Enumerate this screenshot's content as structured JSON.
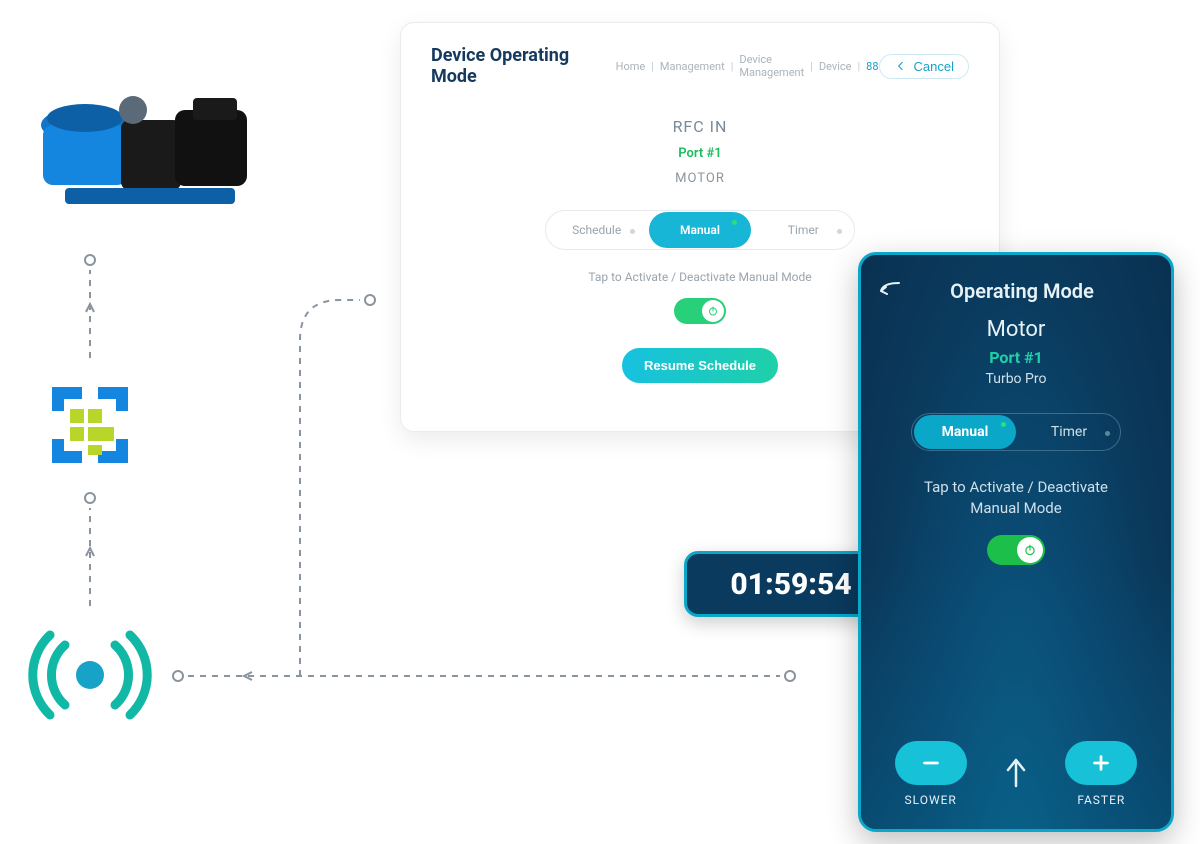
{
  "desktop": {
    "title": "Device Operating Mode",
    "breadcrumb": [
      "Home",
      "Management",
      "Device Management",
      "Device",
      "88"
    ],
    "cancel": "Cancel",
    "rfc": "RFC IN",
    "port": "Port #1",
    "device_type": "MOTOR",
    "segments": {
      "schedule": "Schedule",
      "manual": "Manual",
      "timer": "Timer"
    },
    "tap_text": "Tap to Activate / Deactivate Manual Mode",
    "resume": "Resume Schedule"
  },
  "mobile": {
    "title": "Operating Mode",
    "device_type": "Motor",
    "port": "Port #1",
    "subtitle": "Turbo Pro",
    "segments": {
      "manual": "Manual",
      "timer": "Timer"
    },
    "tap_line1": "Tap to Activate / Deactivate",
    "tap_line2": "Manual Mode",
    "slower": "SLOWER",
    "faster": "FASTER"
  },
  "timer": "01:59:54"
}
